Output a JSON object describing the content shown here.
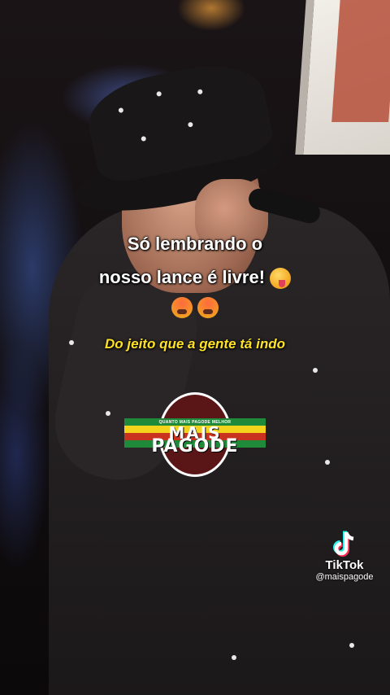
{
  "caption": {
    "line1": "Só  lembrando o",
    "line2": "nosso lance é livre!",
    "line2_emoji": "winking-face-with-tongue",
    "line3_emojis": [
      "hot-face",
      "hot-face"
    ],
    "subtitle": "Do jeito que a gente tá indo"
  },
  "logo": {
    "tagline": "QUANTO MAIS PAGODE MELHOR",
    "word1": "MAIS",
    "word2": "PAGODE",
    "colors": {
      "green": "#1f8a3a",
      "yellow": "#f4d31d",
      "red": "#c8321e",
      "circle": "#5a1616"
    }
  },
  "watermark": {
    "brand": "TikTok",
    "handle": "@maispagode",
    "icon": "tiktok-note-icon"
  }
}
